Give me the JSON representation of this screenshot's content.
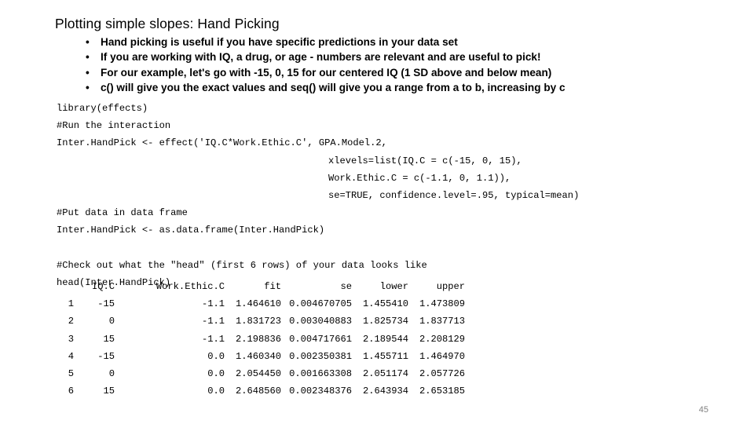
{
  "slide": {
    "title": "Plotting simple slopes: Hand Picking",
    "page_number": "45",
    "page_number_color": "#808080",
    "background_color": "#ffffff",
    "text_color": "#000000"
  },
  "bullets": {
    "marker": "•",
    "items": [
      {
        "text": "Hand picking is useful if you have specific predictions in your data set"
      },
      {
        "text": "If you are working with IQ, a drug, or age - numbers are relevant and are useful to pick!"
      },
      {
        "text": "For our example, let's go with -15, 0, 15 for our centered IQ (1 SD above and below mean)"
      },
      {
        "parts": [
          {
            "text": "c()",
            "bold_code": true
          },
          {
            "text": " will give you the exact values and ",
            "bold_code": false
          },
          {
            "text": "seq()",
            "bold_code": true
          },
          {
            "text": " will give you a range from a to b, increasing by c",
            "bold_code": false
          }
        ]
      }
    ]
  },
  "code": {
    "lines": [
      {
        "text": "library(effects)",
        "indent": false
      },
      {
        "text": "#Run the interaction",
        "indent": false
      },
      {
        "text": "Inter.HandPick <- effect('IQ.C*Work.Ethic.C', GPA.Model.2,",
        "indent": false
      },
      {
        "text": "xlevels=list(IQ.C = c(-15, 0, 15),",
        "indent": true
      },
      {
        "text": "Work.Ethic.C = c(-1.1, 0, 1.1)),",
        "indent": true
      },
      {
        "text": "se=TRUE, confidence.level=.95, typical=mean)",
        "indent": true
      },
      {
        "text": "#Put data in data frame",
        "indent": false
      },
      {
        "text": "Inter.HandPick <- as.data.frame(Inter.HandPick)",
        "indent": false
      },
      {
        "text": "",
        "indent": false
      },
      {
        "text": "#Check out what the \"head\" (first 6 rows) of your data looks like",
        "indent": false
      },
      {
        "text": "head(Inter.HandPick)",
        "indent": false
      }
    ]
  },
  "table": {
    "headers": [
      "",
      "IQ.C",
      "Work.Ethic.C",
      "fit",
      "se",
      "lower",
      "upper"
    ],
    "rows": [
      {
        "cells": [
          "1",
          "-15",
          "-1.1",
          "1.464610",
          "0.004670705",
          "1.455410",
          "1.473809"
        ]
      },
      {
        "cells": [
          "2",
          "0",
          "-1.1",
          "1.831723",
          "0.003040883",
          "1.825734",
          "1.837713"
        ]
      },
      {
        "cells": [
          "3",
          "15",
          "-1.1",
          "2.198836",
          "0.004717661",
          "2.189544",
          "2.208129"
        ]
      },
      {
        "cells": [
          "4",
          "-15",
          "0.0",
          "1.460340",
          "0.002350381",
          "1.455711",
          "1.464970"
        ]
      },
      {
        "cells": [
          "5",
          "0",
          "0.0",
          "2.054450",
          "0.001663308",
          "2.051174",
          "2.057726"
        ]
      },
      {
        "cells": [
          "6",
          "15",
          "0.0",
          "2.648560",
          "0.002348376",
          "2.643934",
          "2.653185"
        ]
      }
    ]
  }
}
